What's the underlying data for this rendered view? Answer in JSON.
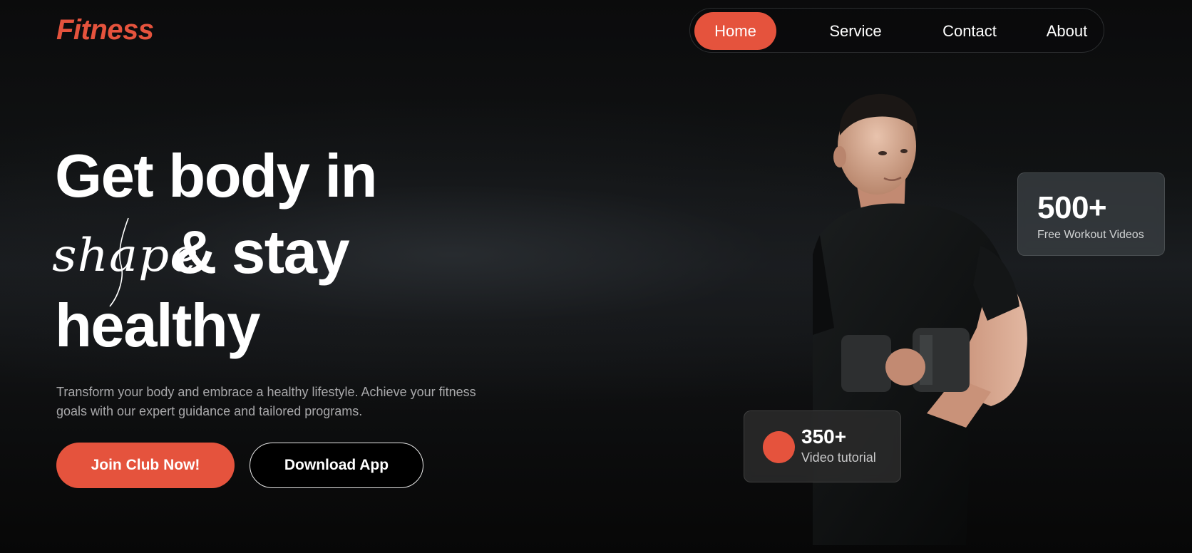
{
  "brand": {
    "logo": "Fitness",
    "accent_color": "#e5533d"
  },
  "nav": {
    "items": [
      {
        "label": "Home",
        "active": true
      },
      {
        "label": "Service",
        "active": false
      },
      {
        "label": "Contact",
        "active": false
      },
      {
        "label": "About",
        "active": false
      }
    ]
  },
  "hero": {
    "line1": "Get body in",
    "script_word": "shape",
    "line2": "& stay",
    "line3": "healthy",
    "description": "Transform your body and embrace a healthy lifestyle. Achieve your fitness goals with our expert guidance and tailored programs.",
    "primary_button": "Join Club Now!",
    "secondary_button": "Download App"
  },
  "stats": {
    "workouts": {
      "value": "500+",
      "label": "Free Workout Videos"
    },
    "tutorials": {
      "value": "350+",
      "label": "Video tutorial"
    }
  },
  "image": {
    "subject": "man in black t-shirt holding a dumbbell",
    "icon": "person-dumbbell-photo"
  }
}
